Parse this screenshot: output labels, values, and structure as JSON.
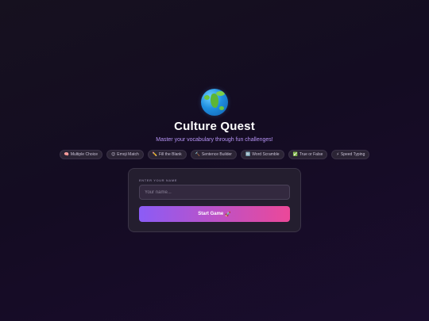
{
  "app": {
    "logo_icon": "globe-africa-icon",
    "title": "Culture Quest",
    "subtitle": "Master your vocabulary through fun challenges!"
  },
  "modes": [
    {
      "icon": "🧠",
      "icon_name": "brain-icon",
      "label": "Multiple Choice"
    },
    {
      "icon": "😊",
      "icon_name": "smile-icon",
      "label": "Emoji Match"
    },
    {
      "icon": "✏️",
      "icon_name": "pencil-icon",
      "label": "Fill the Blank"
    },
    {
      "icon": "🔨",
      "icon_name": "hammer-icon",
      "label": "Sentence Builder"
    },
    {
      "icon": "🔤",
      "icon_name": "letters-icon",
      "label": "Word Scramble"
    },
    {
      "icon": "✅",
      "icon_name": "check-icon",
      "label": "True or False"
    },
    {
      "icon": "⚡",
      "icon_name": "lightning-icon",
      "label": "Speed Typing"
    }
  ],
  "form": {
    "name_label": "Enter your name",
    "name_value": "",
    "name_placeholder": "Your name...",
    "start_label": "Start Game",
    "start_icon": "🚀",
    "start_icon_name": "rocket-icon"
  },
  "colors": {
    "background": "#140c22",
    "accent_start": "#8b5cf6",
    "accent_end": "#ec4899",
    "subtitle": "#b794f6"
  }
}
